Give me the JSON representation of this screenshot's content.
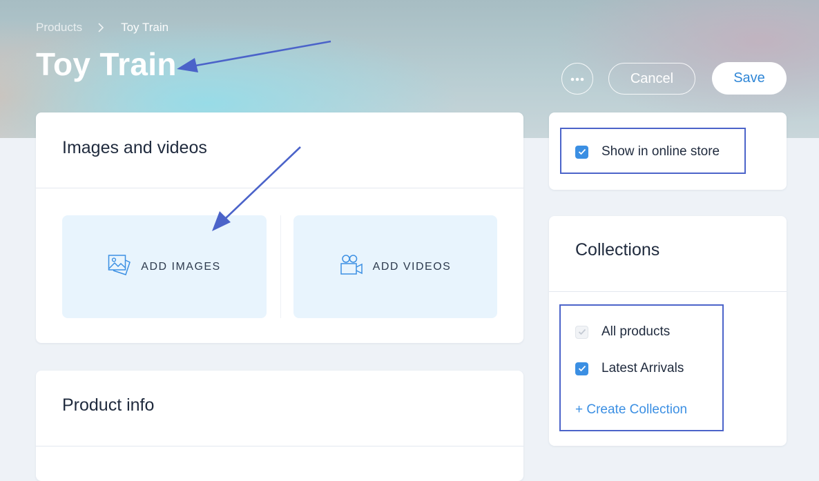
{
  "breadcrumb": {
    "parent": "Products",
    "current": "Toy Train"
  },
  "page": {
    "title": "Toy Train"
  },
  "actions": {
    "more_icon": "more-horizontal-icon",
    "cancel_label": "Cancel",
    "save_label": "Save"
  },
  "media": {
    "title": "Images and videos",
    "add_images_label": "ADD IMAGES",
    "add_videos_label": "ADD VIDEOS"
  },
  "product_info": {
    "title": "Product info"
  },
  "visibility": {
    "show_in_store_label": "Show in online store",
    "show_in_store_checked": true
  },
  "collections": {
    "title": "Collections",
    "items": [
      {
        "label": "All products",
        "checked": true,
        "disabled": true
      },
      {
        "label": "Latest Arrivals",
        "checked": true,
        "disabled": false
      }
    ],
    "create_label": "+ Create Collection"
  },
  "colors": {
    "accent": "#3b8fe3",
    "annotation": "#4b63c9",
    "tile_bg": "#e8f4fd"
  }
}
